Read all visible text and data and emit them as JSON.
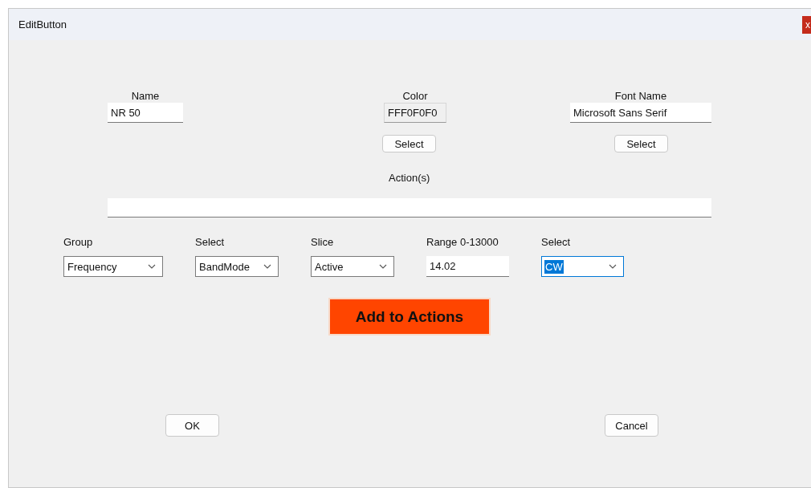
{
  "window": {
    "title": "EditButton",
    "close": "x"
  },
  "fields": [
    {
      "label": "Name",
      "value": "NR 50",
      "readonly": false
    },
    {
      "label": "Color",
      "value": "FFF0F0F0",
      "readonly": true,
      "button": "Select"
    },
    {
      "label": "Font Name",
      "value": "Microsoft Sans Serif",
      "readonly": false,
      "button": "Select"
    }
  ],
  "actions": {
    "label": "Action(s)"
  },
  "selectors": [
    {
      "label": "Group",
      "kind": "combo",
      "value": "Frequency",
      "focused": false
    },
    {
      "label": "Select",
      "kind": "combo",
      "value": "BandMode",
      "focused": false
    },
    {
      "label": "Slice",
      "kind": "combo",
      "value": "Active",
      "focused": false
    },
    {
      "label": "Range 0-13000",
      "kind": "text",
      "value": "14.02",
      "focused": false
    },
    {
      "label": "Select",
      "kind": "combo",
      "value": "CW",
      "focused": true
    }
  ],
  "add_button": "Add to Actions",
  "buttons": [
    "OK",
    "Cancel"
  ]
}
